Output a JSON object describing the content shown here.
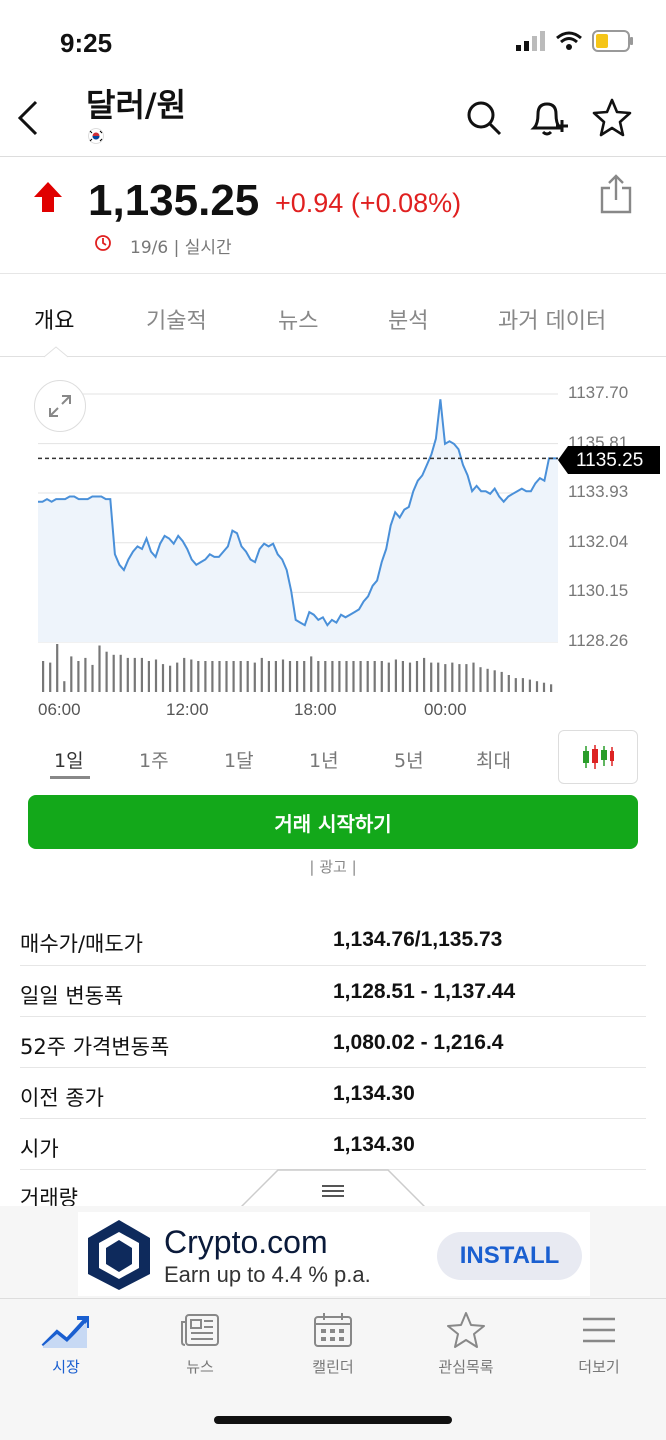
{
  "status": {
    "time": "9:25"
  },
  "header": {
    "title": "달러/원",
    "flag": "korea-flag-icon"
  },
  "quote": {
    "price": "1,135.25",
    "change": "+0.94 (+0.08%)",
    "date": "19/6",
    "realtime": "실시간",
    "direction": "up",
    "up_color": "#e02020"
  },
  "tabs": [
    "개요",
    "기술적",
    "뉴스",
    "분석",
    "과거 데이터"
  ],
  "chart_data": {
    "type": "area",
    "title": "",
    "xlabel": "",
    "ylabel": "",
    "y_ticks": [
      "1137.70",
      "1135.81",
      "1133.93",
      "1132.04",
      "1130.15",
      "1128.26"
    ],
    "x_ticks": [
      "06:00",
      "12:00",
      "18:00",
      "00:00"
    ],
    "ylim": [
      1128.26,
      1137.7
    ],
    "current_price": "1135.25",
    "series": [
      {
        "values": [
          1133.6,
          1133.6,
          1133.7,
          1133.6,
          1133.7,
          1133.7,
          1133.7,
          1133.8,
          1133.8,
          1133.7,
          1133.7,
          1133.7,
          1133.8,
          1133.8,
          1133.8,
          1133.7,
          1133.7,
          1131.6,
          1131.2,
          1131.0,
          1131.4,
          1131.7,
          1131.9,
          1131.8,
          1132.2,
          1131.7,
          1131.5,
          1132.0,
          1132.3,
          1132.2,
          1132.0,
          1132.3,
          1132.1,
          1131.8,
          1131.4,
          1131.2,
          1131.3,
          1131.4,
          1131.6,
          1131.5,
          1131.5,
          1131.7,
          1131.9,
          1132.5,
          1132.4,
          1131.9,
          1131.7,
          1131.4,
          1131.3,
          1131.8,
          1132.0,
          1131.9,
          1132.0,
          1131.6,
          1131.4,
          1131.0,
          1130.2,
          1129.1,
          1129.0,
          1128.9,
          1129.4,
          1129.3,
          1129.1,
          1129.2,
          1128.9,
          1129.1,
          1129.0,
          1129.3,
          1129.2,
          1129.3,
          1129.4,
          1129.5,
          1129.8,
          1130.0,
          1130.4,
          1130.6,
          1131.3,
          1131.8,
          1132.7,
          1133.2,
          1133.0,
          1133.3,
          1133.4,
          1134.0,
          1134.4,
          1134.6,
          1135.0,
          1135.4,
          1136.0,
          1137.5,
          1135.8,
          1135.9,
          1135.8,
          1135.6,
          1135.0,
          1134.6,
          1134.0,
          1134.2,
          1134.0,
          1134.0,
          1133.9,
          1134.1,
          1133.8,
          1133.6,
          1133.8,
          1133.9,
          1134.0,
          1134.1,
          1134.0,
          1134.0,
          1134.3,
          1134.5,
          1134.4,
          1135.25,
          1135.25,
          1135.25
        ]
      }
    ],
    "volume": [
      40,
      38,
      62,
      14,
      46,
      40,
      44,
      35,
      60,
      52,
      48,
      48,
      44,
      44,
      44,
      40,
      42,
      36,
      34,
      38,
      44,
      42,
      40,
      40,
      40,
      40,
      40,
      40,
      40,
      40,
      38,
      44,
      40,
      40,
      42,
      40,
      40,
      40,
      46,
      40,
      40,
      40,
      40,
      40,
      40,
      40,
      40,
      40,
      40,
      38,
      42,
      40,
      38,
      40,
      44,
      38,
      38,
      36,
      38,
      36,
      36,
      38,
      32,
      30,
      28,
      26,
      22,
      18,
      18,
      16,
      14,
      12,
      10
    ],
    "area_color": "#eef4fb",
    "line_color": "#4a90d9"
  },
  "periods": [
    "1일",
    "1주",
    "1달",
    "1년",
    "5년",
    "최대"
  ],
  "trade_button": "거래 시작하기",
  "ad_label": "| 광고 |",
  "stats": [
    {
      "label": "매수가/매도가",
      "value": "1,134.76/1,135.73"
    },
    {
      "label": "일일 변동폭",
      "value": "1,128.51 - 1,137.44"
    },
    {
      "label": "52주 가격변동폭",
      "value": "1,080.02 - 1,216.4"
    },
    {
      "label": "이전 종가",
      "value": "1,134.30"
    },
    {
      "label": "시가",
      "value": "1,134.30"
    },
    {
      "label": "거래량",
      "value": ""
    }
  ],
  "ad": {
    "brand": "Crypto.com",
    "sub": "Earn up to 4.4 % p.a.",
    "cta": "INSTALL"
  },
  "nav": [
    {
      "label": "시장",
      "icon": "chart-line-icon"
    },
    {
      "label": "뉴스",
      "icon": "newspaper-icon"
    },
    {
      "label": "캘린더",
      "icon": "calendar-icon"
    },
    {
      "label": "관심목록",
      "icon": "star-icon"
    },
    {
      "label": "더보기",
      "icon": "menu-icon"
    }
  ]
}
